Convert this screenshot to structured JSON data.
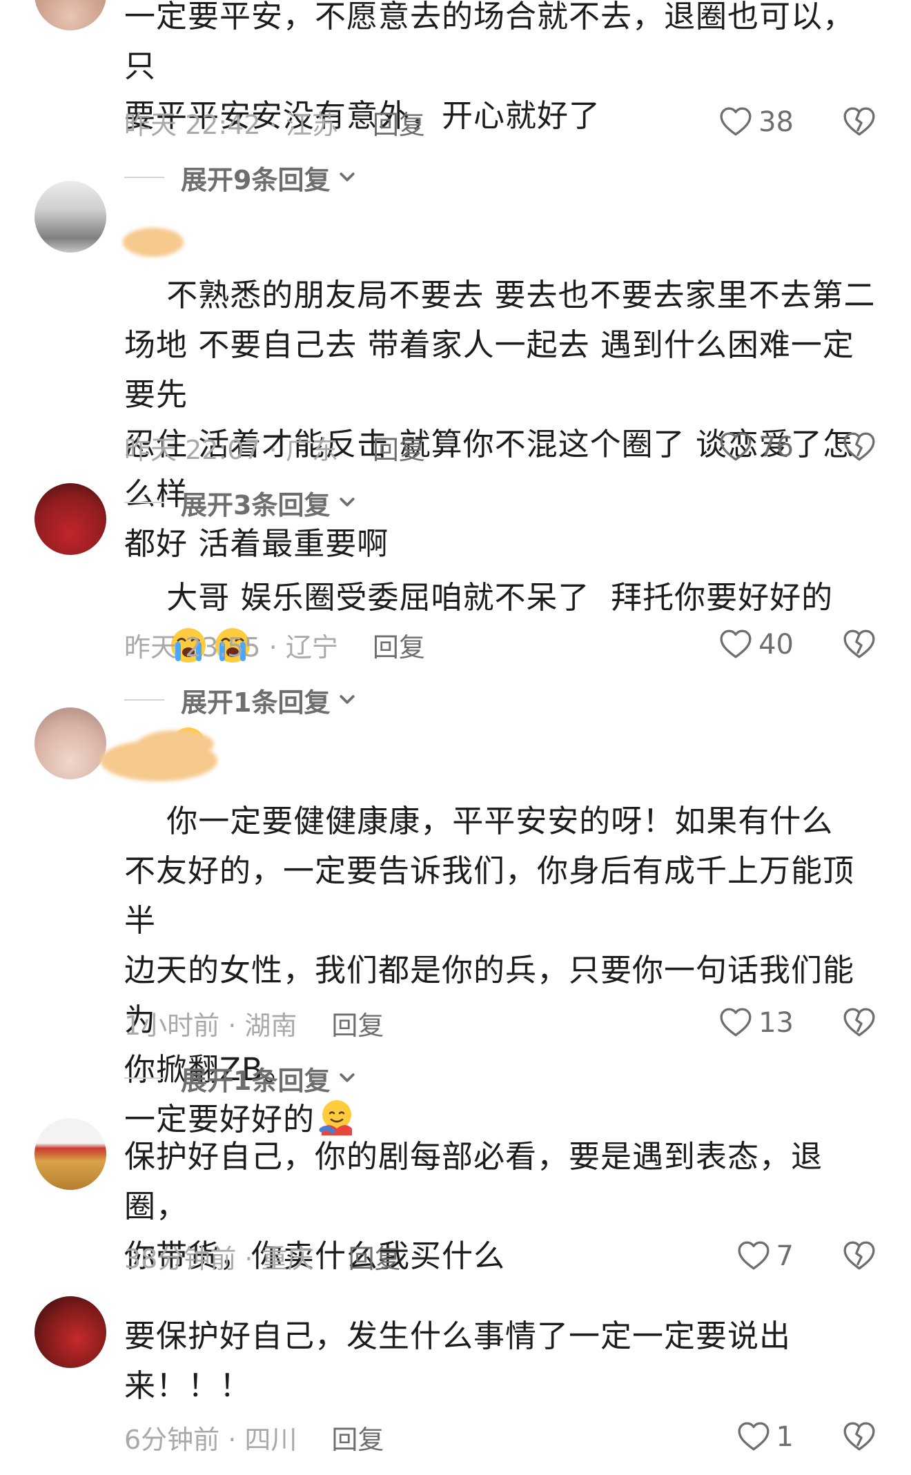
{
  "comments": [
    {
      "text": "一定要平安，不愿意去的场合就不去，退圈也可以，只\n要平平安安没有意外，开心就好了",
      "time": "昨天 22:42 · 江苏",
      "reply": "回复",
      "likes": "38",
      "expand": "展开9条回复"
    },
    {
      "text": "不熟悉的朋友局不要去 要去也不要去家里不去第二\n场地 不要自己去 带着家人一起去 遇到什么困难一定要先\n忍住 活着才能反击 就算你不混这个圈了 谈恋爱了怎么样\n都好 活着最重要啊",
      "time": "昨天 22:07 · 广东",
      "reply": "回复",
      "likes": "76",
      "expand": "展开3条回复"
    },
    {
      "text": "大哥 娱乐圈受委屈咱就不呆了  拜托你要好好的",
      "time": "昨天 23:55 · 辽宁",
      "reply": "回复",
      "likes": "40",
      "expand": "展开1条回复"
    },
    {
      "text": "你一定要健健康康，平平安安的呀！如果有什么\n不友好的，一定要告诉我们，你身后有成千上万能顶半\n边天的女性，我们都是你的兵，只要你一句话我们能为\n你掀翻ZB。\n一定要好好的",
      "time": "1小时前 · 湖南",
      "reply": "回复",
      "likes": "13",
      "expand": "展开1条回复"
    },
    {
      "text": "保护好自己，你的剧每部必看，要是遇到表态，退圈，\n你带货，你卖什么我买什么",
      "time": "38分钟前 · 重庆",
      "reply": "回复",
      "likes": "7"
    },
    {
      "text": "要保护好自己，发生什么事情了一定一定要说出\n来！！！",
      "time": "6分钟前 · 四川",
      "reply": "回复",
      "likes": "1"
    }
  ],
  "icons": {
    "like": "heart-outline-icon",
    "dislike": "broken-heart-icon",
    "expand": "chevron-down-icon",
    "emoji_cry": "loudly-crying-face-emoji",
    "emoji_hug": "hugging-face-emoji"
  },
  "colors": {
    "text": "#1c1c1c",
    "meta": "#a9a9a9",
    "reply": "#6e6e6e",
    "background": "#ffffff"
  }
}
